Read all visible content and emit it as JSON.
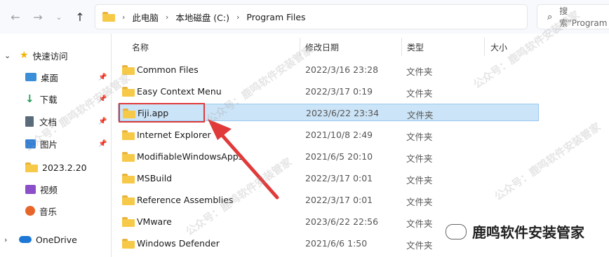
{
  "address": {
    "crumbs": [
      "此电脑",
      "本地磁盘 (C:)",
      "Program Files"
    ]
  },
  "search": {
    "placeholder": "搜索\"Program"
  },
  "sidebar": {
    "quick_access": "快速访问",
    "items": [
      {
        "label": "桌面",
        "pinned": true
      },
      {
        "label": "下载",
        "pinned": true
      },
      {
        "label": "文档",
        "pinned": true
      },
      {
        "label": "图片",
        "pinned": true
      },
      {
        "label": "2023.2.20",
        "pinned": false
      },
      {
        "label": "视频",
        "pinned": false
      },
      {
        "label": "音乐",
        "pinned": false
      }
    ],
    "onedrive": "OneDrive"
  },
  "columns": {
    "name": "名称",
    "modified": "修改日期",
    "type": "类型",
    "size": "大小"
  },
  "files": [
    {
      "name": "Common Files",
      "date": "2022/3/16 23:28",
      "type": "文件夹"
    },
    {
      "name": "Easy Context Menu",
      "date": "2022/3/17 0:19",
      "type": "文件夹"
    },
    {
      "name": "Fiji.app",
      "date": "2023/6/22 23:34",
      "type": "文件夹",
      "selected": true
    },
    {
      "name": "Internet Explorer",
      "date": "2021/10/8 2:49",
      "type": "文件夹"
    },
    {
      "name": "ModifiableWindowsApps",
      "date": "2021/6/5 20:10",
      "type": "文件夹"
    },
    {
      "name": "MSBuild",
      "date": "2022/3/17 0:01",
      "type": "文件夹"
    },
    {
      "name": "Reference Assemblies",
      "date": "2022/3/17 0:01",
      "type": "文件夹"
    },
    {
      "name": "VMware",
      "date": "2023/6/22 22:56",
      "type": "文件夹"
    },
    {
      "name": "Windows Defender",
      "date": "2021/6/6 1:50",
      "type": "文件夹"
    }
  ],
  "watermark": {
    "brand": "鹿鸣软件安装管家",
    "handle": "公众号：鹿鸣软件安装管家"
  },
  "colors": {
    "selection": "#cce4f7",
    "annotation": "#e03a3a",
    "folder": "#f7c948"
  }
}
